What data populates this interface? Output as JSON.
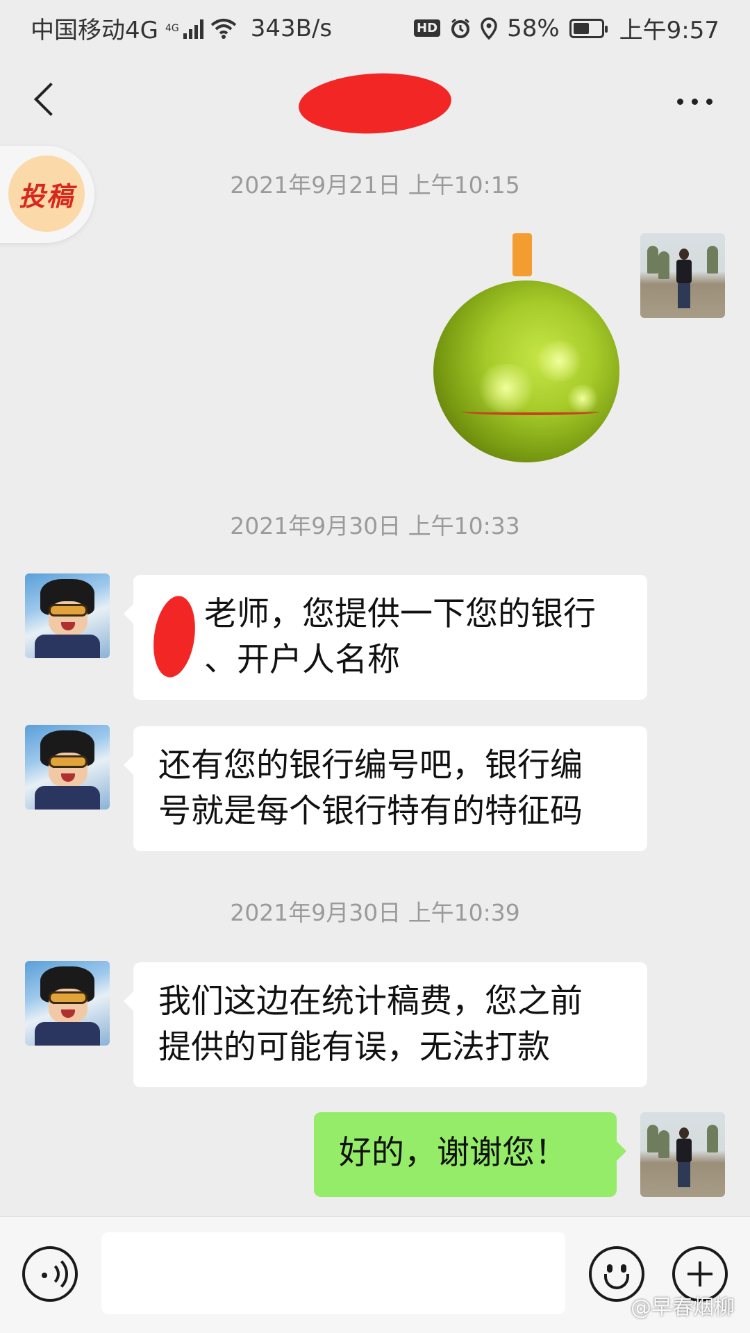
{
  "status_bar": {
    "carrier": "中国移动4G",
    "network_badge": "4G",
    "speed": "343B/s",
    "hd_badge": "HD",
    "battery": "58%",
    "battery_level": 0.58,
    "time": "上午9:57"
  },
  "nav": {
    "title_redacted": true
  },
  "floating_badge": {
    "label": "投稿"
  },
  "messages": [
    {
      "type": "timestamp",
      "text": "2021年9月21日 上午10:15"
    },
    {
      "type": "sticker",
      "sender": "me",
      "icon": "green-ball-sticker"
    },
    {
      "type": "timestamp",
      "text": "2021年9月30日 上午10:33"
    },
    {
      "type": "text",
      "sender": "other",
      "text": "老师，您提供一下您的银行\n、开户人名称"
    },
    {
      "type": "text",
      "sender": "other",
      "text": "还有您的银行编号吧，银行编\n号就是每个银行特有的特征码"
    },
    {
      "type": "timestamp",
      "text": "2021年9月30日 上午10:39"
    },
    {
      "type": "text",
      "sender": "other",
      "text": "我们这边在统计稿费，您之前\n提供的可能有误，无法打款"
    },
    {
      "type": "text",
      "sender": "me",
      "text": "好的，谢谢您！"
    }
  ],
  "input_bar": {
    "voice_icon": "voice-icon",
    "emoji_icon": "emoji-icon",
    "plus_icon": "plus-icon",
    "input_value": ""
  },
  "watermark": "@早春烟柳",
  "colors": {
    "background": "#ededed",
    "outgoing_bubble": "#95ec69",
    "incoming_bubble": "#ffffff",
    "redaction": "#f32626"
  }
}
